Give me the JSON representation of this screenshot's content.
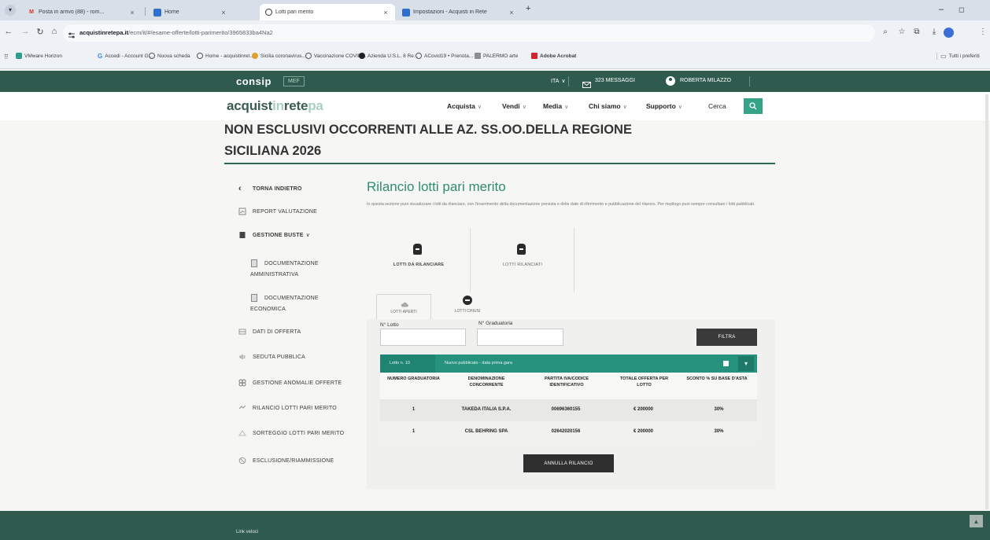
{
  "colors": {
    "chrome_tabbar": "#d7dfe8",
    "chrome_toolbar": "#eef2f6",
    "brand_dark": "#2f5b4e",
    "title_green": "#2e8c72",
    "table_header": "#26917d",
    "search_button": "#35a387",
    "button_dark": "#3a3a3a"
  },
  "browser": {
    "tabs": [
      {
        "label": "Posta in arrivo (88) - rom...",
        "icon": "gmail-icon"
      },
      {
        "label": "Home",
        "icon": "app-icon"
      },
      {
        "label": "Lotti pari merito",
        "icon": "site-icon"
      },
      {
        "label": "Impostazioni - Acquisti in Rete",
        "icon": "app-icon"
      }
    ],
    "url_host": "acquistinretepa.it",
    "url_path": "/ecm/it/#/esame-offerte/lotti-parimerito/3965833ba4Na2",
    "bookmarks": [
      {
        "label": "VMware Horizon",
        "icon": "vmware-icon"
      },
      {
        "label": "Accedi - Account G...",
        "icon": "google-icon"
      },
      {
        "label": "Nuova scheda",
        "icon": "globe-icon"
      },
      {
        "label": "Home - acquistinret...",
        "icon": "globe-icon"
      },
      {
        "label": "Sicilia coronavirus...",
        "icon": "site-icon"
      },
      {
        "label": "Vaccinazione COVID...",
        "icon": "globe-icon"
      },
      {
        "label": "Azienda U.S.L. 8 Re...",
        "icon": "site-icon"
      },
      {
        "label": "ACovid19 • Prenota...",
        "icon": "globe-icon"
      },
      {
        "label": "PALERMO arte",
        "icon": "site-icon"
      },
      {
        "label": "Adobe Acrobat",
        "icon": "acrobat-icon"
      }
    ],
    "all_bookmarks": "Tutti i preferiti"
  },
  "topbar": {
    "logo": "consip",
    "mef": "MEF",
    "language": "ITA",
    "messages": "323 MESSAGGI",
    "user": "ROBERTA MILAZZO"
  },
  "header": {
    "logo_parts": [
      "acquist",
      "in",
      "rete",
      "pa"
    ],
    "nav": [
      "Acquista",
      "Vendi",
      "Media",
      "Chi siamo",
      "Supporto"
    ],
    "search_label": "Cerca"
  },
  "page": {
    "title_line1": "NON ESCLUSIVI OCCORRENTI ALLE AZ. SS.OO.DELLA REGIONE",
    "title_line2": "SICILIANA 2026"
  },
  "sidebar": {
    "back": "TORNA INDIETRO",
    "items": [
      {
        "label": "REPORT VALUTAZIONE",
        "icon": "report-icon"
      },
      {
        "label": "GESTIONE BUSTE",
        "icon": "folder-icon"
      },
      {
        "label": "DOCUMENTAZIONE AMMINISTRATIVA",
        "icon": "document-icon"
      },
      {
        "label": "DOCUMENTAZIONE ECONOMICA",
        "icon": "document-icon"
      },
      {
        "label": "DATI DI OFFERTA",
        "icon": "list-icon"
      },
      {
        "label": "SEDUTA PUBBLICA",
        "icon": "megaphone-icon"
      },
      {
        "label": "GESTIONE ANOMALIE OFFERTE",
        "icon": "anomaly-icon"
      },
      {
        "label": "RILANCIO LOTTI PARI MERITO",
        "icon": "relaunch-icon"
      },
      {
        "label": "SORTEGGIO LOTTI PARI MERITO",
        "icon": "draw-icon"
      },
      {
        "label": "ESCLUSIONE/RIAMMISSIONE",
        "icon": "exclusion-icon"
      }
    ]
  },
  "main": {
    "title": "Rilancio lotti pari merito",
    "description": "In questa sezione puoi visualizzare i lotti da rilanciare, con l'inserimento della documentazione prevista e delle date di riferimento e pubblicazione del rilancio. Per riepilogo puoi sempre consultare i lotti pubblicati.",
    "cards": [
      "LOTTI DA RILANCIARE",
      "LOTTI RILANCIATI"
    ],
    "subtabs": [
      "LOTTI APERTI",
      "LOTTI CHIUSI"
    ],
    "filters": {
      "lotto_label": "N° Lotto",
      "lotto_value": "",
      "graduatoria_label": "N° Graduatoria",
      "graduatoria_value": "",
      "button": "FILTRA"
    },
    "table": {
      "lotto": "Lotto n. 10",
      "status": "Nuovo pubblicato - data prima gara",
      "columns": [
        "NUMERO GRADUATORIA",
        "DENOMINAZIONE CONCORRENTE",
        "PARTITA IVA/CODICE IDENTIFICATIVO",
        "TOTALE OFFERTA PER LOTTO",
        "SCONTO % SU BASE D'ASTA"
      ],
      "rows": [
        {
          "graduatoria": "1",
          "denominazione": "TAKEDA ITALIA S.P.A.",
          "partita_iva": "00696360155",
          "totale": "€ 200000",
          "sconto": "30%"
        },
        {
          "graduatoria": "1",
          "denominazione": "CSL BEHRING SPA",
          "partita_iva": "02642020156",
          "totale": "€ 200000",
          "sconto": "30%"
        }
      ]
    },
    "cancel_button": "ANNULLA RILANCIO"
  },
  "footer": {
    "quick_links": "Link veloci"
  }
}
